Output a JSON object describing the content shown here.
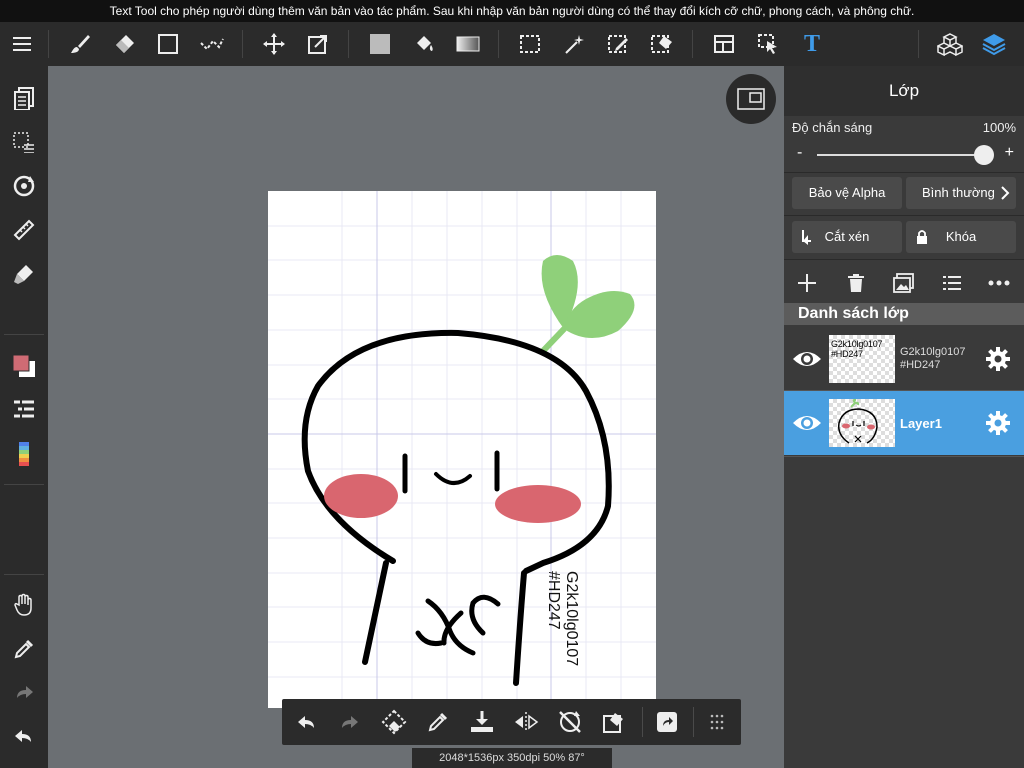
{
  "banner": {
    "text": "Text Tool cho phép người dùng thêm văn bản vào tác phẩm. Sau khi nhập văn bản người dùng có thể thay đổi kích cỡ chữ, phong cách, và phông chữ."
  },
  "status": {
    "text": "2048*1536px 350dpi 50% 87°"
  },
  "colors": {
    "accent": "#4a9fe0",
    "panel_bg": "#3a3a3a",
    "toolbar_bg": "#2b2b2b",
    "canvas_bg": "#6b6f73",
    "main_color": "#cf6b74",
    "text_tool": "#3f9be9",
    "layers_icon": "#3f9be9",
    "sprout": "#8fd07a",
    "blush": "#d9666f"
  },
  "toolbar": {
    "items": [
      "menu-icon",
      "brush-icon",
      "eraser-icon",
      "rectangle-icon",
      "selection-pen-icon",
      "move-icon",
      "transform-icon",
      "fill-color-icon",
      "bucket-icon",
      "gradient-icon",
      "select-rect-icon",
      "magic-wand-icon",
      "select-pen-icon",
      "select-eraser-icon",
      "layout-icon",
      "operation-icon",
      "text-icon",
      "materials-icon",
      "layers-icon"
    ],
    "text_glyph": "T"
  },
  "panel": {
    "title": "Lớp",
    "opacity": {
      "label": "Độ chắn sáng",
      "value": "100%",
      "level": 1.0,
      "minus": "-",
      "plus": "+"
    },
    "alpha_protect": "Bảo vệ Alpha",
    "blend_mode": "Bình thường",
    "clipping": "Cắt xén",
    "lock": "Khóa",
    "list_header": "Danh sách lớp",
    "layers": [
      {
        "name": "G2k10lg0107\n#HD247",
        "thumb_text": "G2k10lg0107\n#HD247",
        "selected": false
      },
      {
        "name": "Layer1",
        "selected": true
      }
    ]
  },
  "canvas": {
    "watermark_line1": "G2k10lg0107",
    "watermark_line2": "#HD247"
  }
}
